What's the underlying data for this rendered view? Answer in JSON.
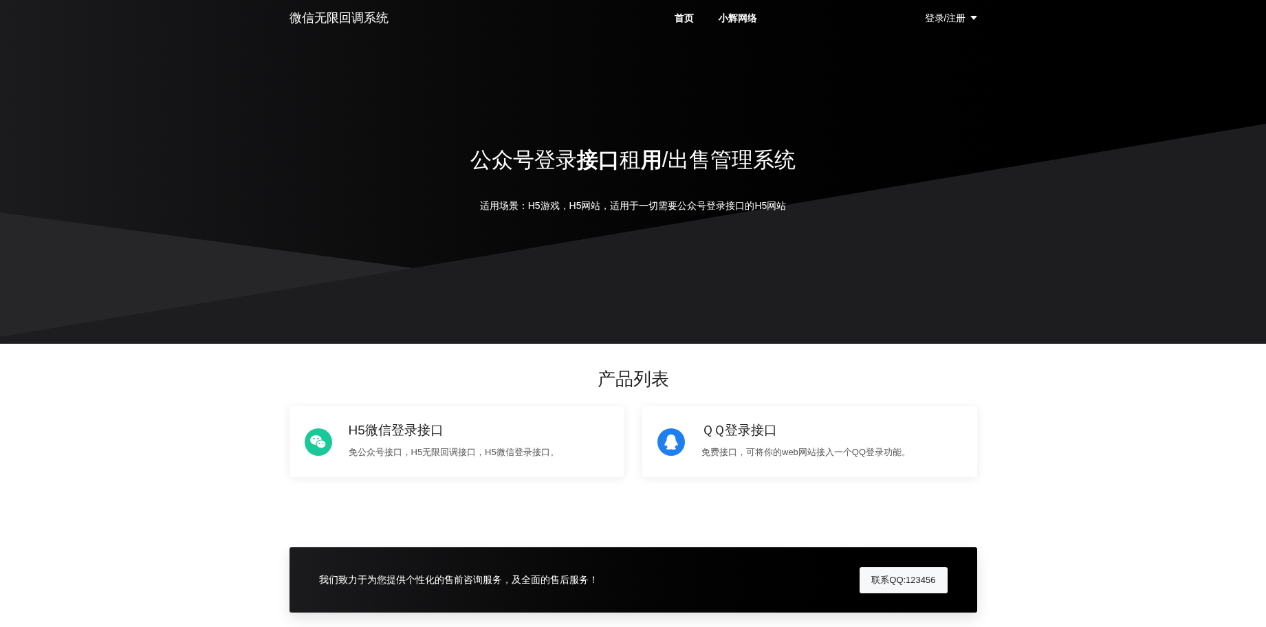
{
  "navbar": {
    "brand": "微信无限回调系统",
    "links": [
      {
        "label": "首页"
      },
      {
        "label": "小辉网络"
      }
    ],
    "account": {
      "label": "登录/注册"
    }
  },
  "hero": {
    "title": "公众号登录**接口**租**用**/出售管理系统",
    "subtitle": "适用场景：H5游戏，H5网站，适用于一切需要公众号登录接口的H5网站"
  },
  "products": {
    "heading": "产品列表",
    "items": [
      {
        "kind": "wechat",
        "title": "H5微信登录接口",
        "description": "免公众号接口，H5无限回调接口，H5微信登录接口。",
        "color": "#19c99a"
      },
      {
        "kind": "qq",
        "title": "ＱＱ登录接口",
        "description": "免费接口，可将你的web网站接入一个QQ登录功能。",
        "color": "#1e7ff0"
      }
    ]
  },
  "banner": {
    "text": "我们致力于为您提供个性化的售前咨询服务，及全面的售后服务！",
    "button": "联系QQ:123456"
  }
}
